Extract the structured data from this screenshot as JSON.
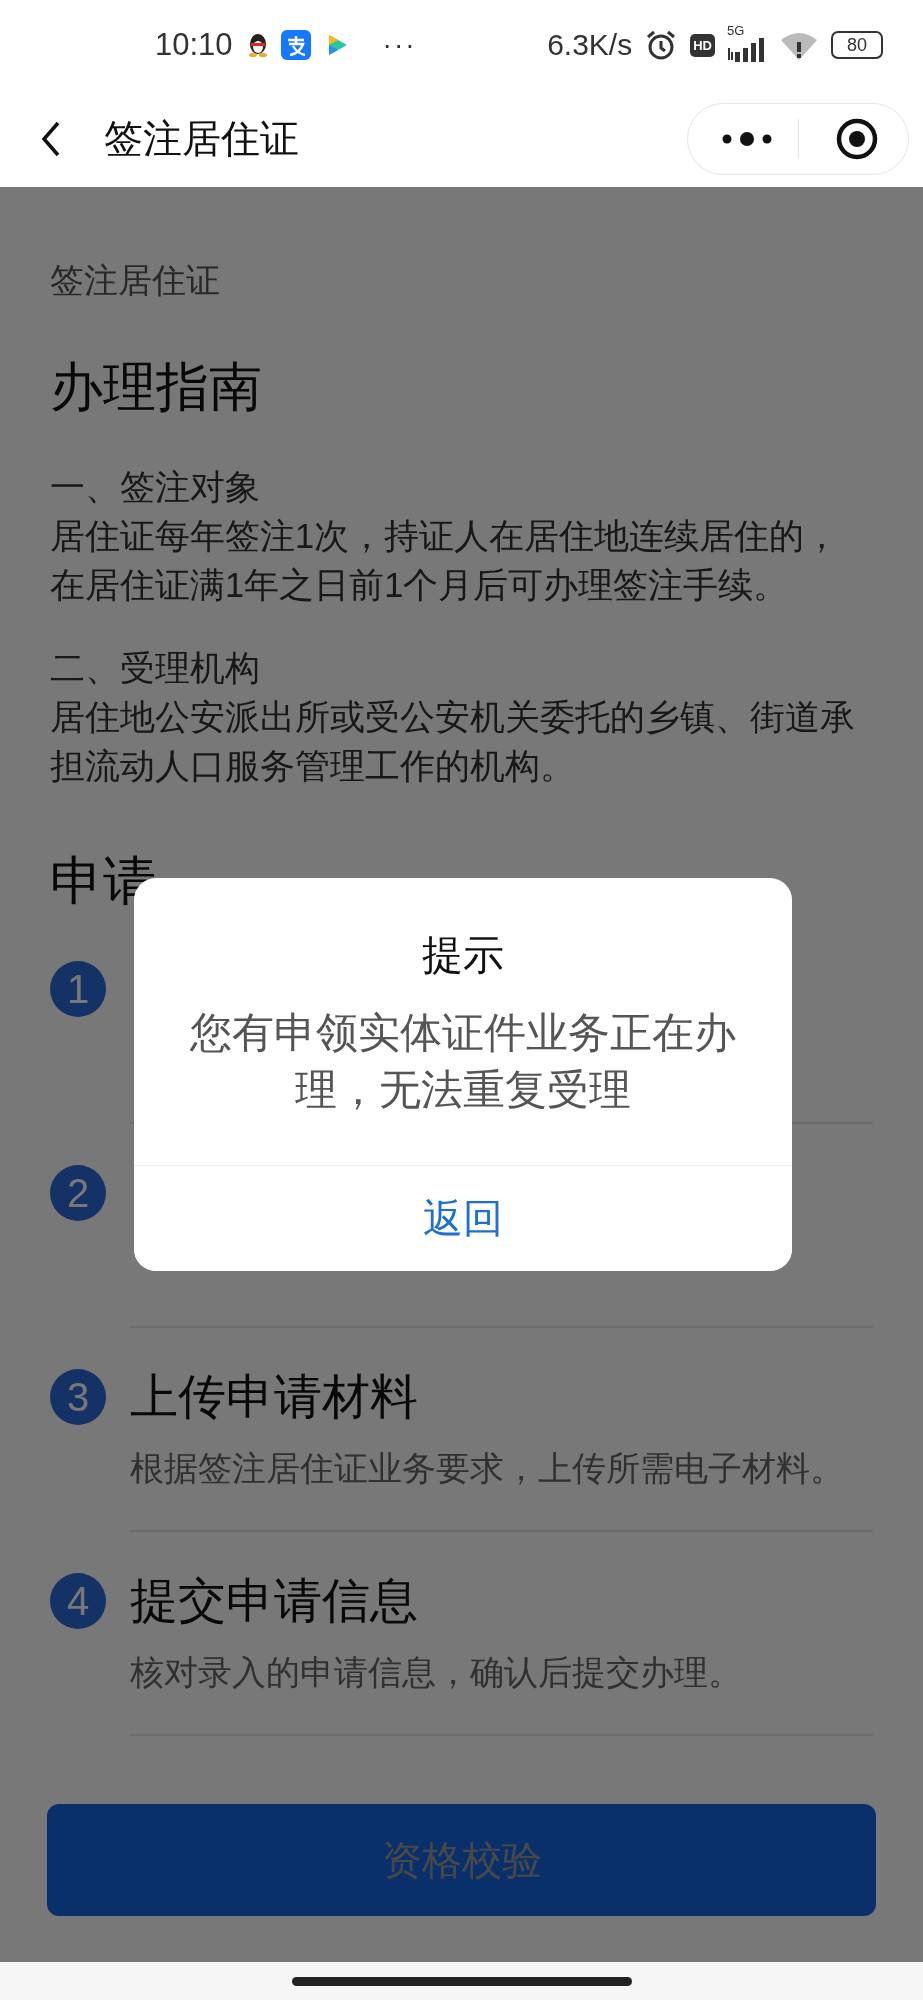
{
  "status_bar": {
    "time": "10:10",
    "more": "···",
    "speed": "6.3K/s",
    "hd": "HD",
    "network": "5G",
    "battery": "80"
  },
  "header": {
    "title": "签注居住证"
  },
  "sections": [
    {
      "paragraphs": [
        {
          "body": "签注居住证"
        }
      ],
      "kind": "plain"
    },
    {
      "heading": "办理指南",
      "paragraphs": [
        {
          "label": "一、签注对象",
          "body": "居住证每年签注1次，持证人在居住地连续居住的，在居住证满1年之日前1个月后可办理签注手续。"
        },
        {
          "label": "二、受理机构",
          "body": "居住地公安派出所或受公安机关委托的乡镇、街道承担流动人口服务管理工作的机构。"
        }
      ],
      "kind": "guide"
    }
  ],
  "steps_heading": "申请",
  "steps": [
    {
      "number": "1"
    },
    {
      "number": "2"
    },
    {
      "number": "3",
      "title": "上传申请材料",
      "description": "根据签注居住证业务要求，上传所需电子材料。"
    },
    {
      "number": "4",
      "title": "提交申请信息",
      "description": "核对录入的申请信息，确认后提交办理。"
    }
  ],
  "primary_button": {
    "label": "资格校验"
  },
  "dialog": {
    "title": "提示",
    "message": "您有申领实体证件业务正在办理，无法重复受理",
    "button": "返回"
  }
}
